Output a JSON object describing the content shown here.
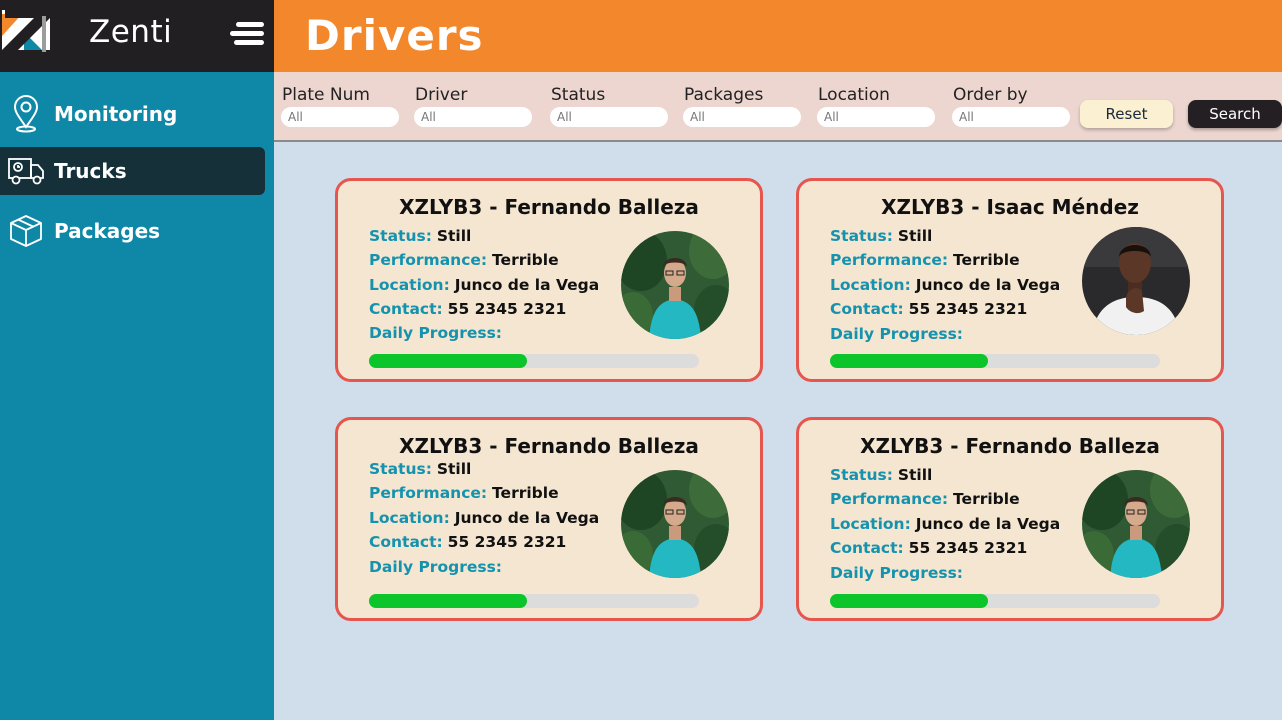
{
  "brand": {
    "name": "Zenti"
  },
  "sidebar": {
    "items": [
      {
        "label": "Monitoring",
        "icon": "location-pin-icon",
        "active": false
      },
      {
        "label": "Trucks",
        "icon": "truck-icon",
        "active": true
      },
      {
        "label": "Packages",
        "icon": "box-icon",
        "active": false
      }
    ]
  },
  "header": {
    "title": "Drivers"
  },
  "filters": [
    {
      "label": "Plate Num",
      "placeholder": "All"
    },
    {
      "label": "Driver",
      "placeholder": "All"
    },
    {
      "label": "Status",
      "placeholder": "All"
    },
    {
      "label": "Packages",
      "placeholder": "All"
    },
    {
      "label": "Location",
      "placeholder": "All"
    },
    {
      "label": "Order by",
      "placeholder": "All"
    }
  ],
  "buttons": {
    "reset": "Reset",
    "search": "Search"
  },
  "field_labels": {
    "status": "Status:",
    "performance": "Performance:",
    "location": "Location:",
    "contact": "Contact:",
    "progress": "Daily Progress:"
  },
  "drivers": [
    {
      "title": "XZLYB3 - Fernando Balleza",
      "status": "Still",
      "performance": "Terrible",
      "location": "Junco de la Vega",
      "contact": "55 2345 2321",
      "progress": 0.48,
      "avatar": "man-glasses-teal-shirt"
    },
    {
      "title": "XZLYB3 - Isaac Méndez",
      "status": "Still",
      "performance": "Terrible",
      "location": "Junco de la Vega",
      "contact": "55 2345 2321",
      "progress": 0.48,
      "avatar": "man-white-shirt"
    },
    {
      "title": "XZLYB3 - Fernando Balleza",
      "status": "Still",
      "performance": "Terrible",
      "location": "Junco de la Vega",
      "contact": "55 2345 2321",
      "progress": 0.48,
      "avatar": "man-glasses-teal-shirt"
    },
    {
      "title": "XZLYB3 - Fernando Balleza",
      "status": "Still",
      "performance": "Terrible",
      "location": "Junco de la Vega",
      "contact": "55 2345 2321",
      "progress": 0.48,
      "avatar": "man-glasses-teal-shirt"
    }
  ],
  "colors": {
    "sidebar": "#0f88a8",
    "header": "#f2872b",
    "card_border": "#e5564f",
    "progress": "#0bc52a",
    "label_accent": "#1592ae"
  }
}
